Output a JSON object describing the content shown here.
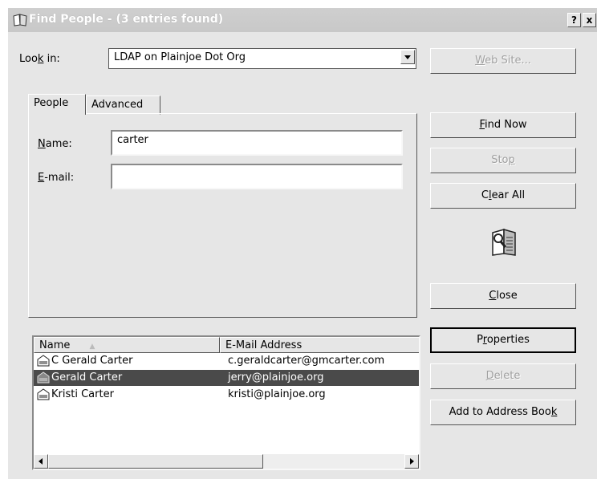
{
  "window": {
    "title": "Find People - (3 entries found)",
    "help_label": "?",
    "close_label": "x",
    "icon": "address-book-icon"
  },
  "look_in": {
    "label": "Look in:",
    "label_pre": "Loo",
    "label_key": "k",
    "label_post": " in:",
    "value": "LDAP on Plainjoe Dot Org"
  },
  "tabs": [
    {
      "label": "People",
      "active": true
    },
    {
      "label": "Advanced",
      "active": false
    }
  ],
  "form": {
    "name_label_key": "N",
    "name_label_rest": "ame:",
    "name_value": "carter",
    "email_label_key": "E",
    "email_label_rest": "-mail:",
    "email_value": ""
  },
  "buttons": {
    "web_site": {
      "key": "W",
      "rest": "eb Site..."
    },
    "find_now": {
      "key": "F",
      "rest": "ind Now"
    },
    "stop": {
      "pre": "Sto",
      "key": "p"
    },
    "clear_all": {
      "pre": "C",
      "key": "l",
      "rest": "ear All"
    },
    "close": {
      "key": "C",
      "rest": "lose"
    },
    "properties": {
      "pre": "P",
      "key": "r",
      "rest": "operties"
    },
    "delete": {
      "key": "D",
      "rest": "elete"
    },
    "add_to_address_book": {
      "pre": "Add to Address Boo",
      "key": "k"
    }
  },
  "results": {
    "columns": [
      "Name",
      "E-Mail Address"
    ],
    "sort_indicator": "▲",
    "rows": [
      {
        "name": "C Gerald Carter",
        "email": "c.geraldcarter@gmcarter.com",
        "selected": false
      },
      {
        "name": "Gerald Carter",
        "email": "jerry@plainjoe.org",
        "selected": true
      },
      {
        "name": "Kristi Carter",
        "email": "kristi@plainjoe.org",
        "selected": false
      }
    ]
  },
  "icons": [
    "address-book-icon",
    "help-icon",
    "close-icon",
    "chevron-down-icon",
    "find-people-icon",
    "contact-card-icon",
    "scroll-left-icon",
    "scroll-right-icon"
  ],
  "colors": {
    "selection": "#4a4a4a",
    "face": "#e6e6e6"
  }
}
